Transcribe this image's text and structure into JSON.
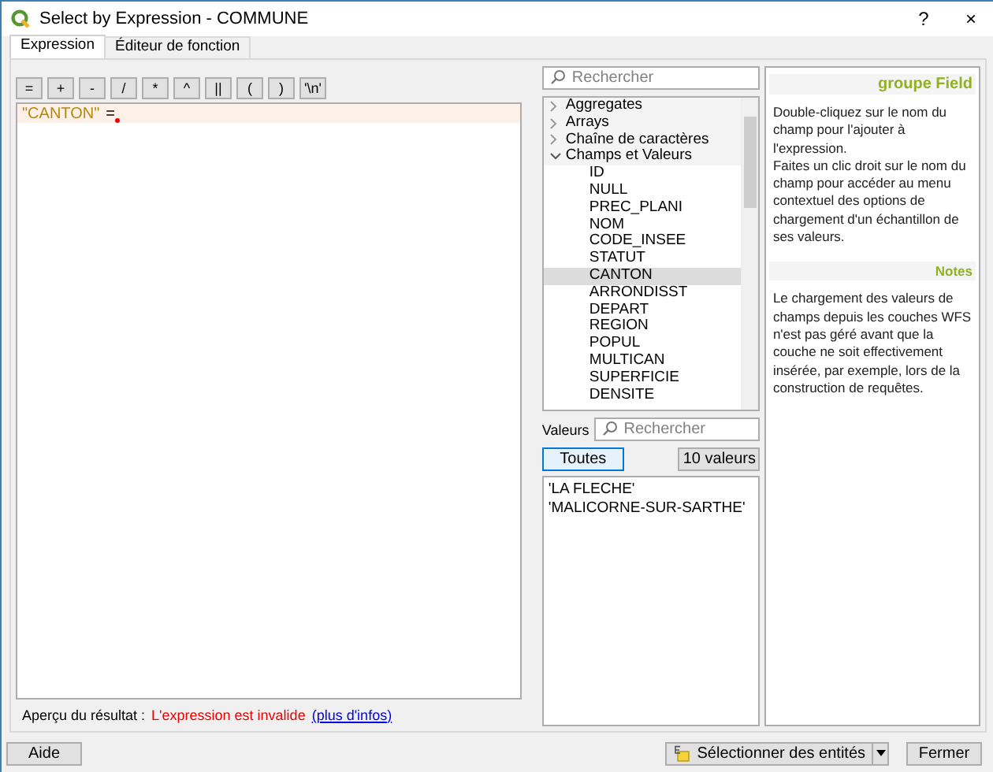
{
  "window": {
    "title": "Select by Expression - COMMUNE",
    "help_button": "?",
    "close_button": "×"
  },
  "tabs": [
    {
      "label": "Expression",
      "selected": true
    },
    {
      "label": "Éditeur de fonction",
      "selected": false
    }
  ],
  "operators": [
    "=",
    "+",
    "-",
    "/",
    "*",
    "^",
    "||",
    "(",
    ")",
    "'\\n'"
  ],
  "expression": {
    "tokens": [
      {
        "text": "\"CANTON\"",
        "kind": "field"
      },
      {
        "text": "=",
        "kind": "operator"
      }
    ],
    "error": true
  },
  "preview": {
    "label": "Aperçu du résultat :",
    "message": "L'expression est invalide",
    "link": "(plus d'infos)"
  },
  "function_search": {
    "placeholder": "Rechercher"
  },
  "tree": [
    {
      "label": "Aggregates",
      "expanded": false,
      "selected": false
    },
    {
      "label": "Arrays",
      "expanded": false,
      "selected": false
    },
    {
      "label": "Chaîne de caractères",
      "expanded": false,
      "selected": false
    },
    {
      "label": "Champs et Valeurs",
      "expanded": true,
      "selected": false,
      "children": [
        {
          "label": "ID",
          "selected": false
        },
        {
          "label": "NULL",
          "selected": false
        },
        {
          "label": "PREC_PLANI",
          "selected": false
        },
        {
          "label": "NOM",
          "selected": false
        },
        {
          "label": "CODE_INSEE",
          "selected": false
        },
        {
          "label": "STATUT",
          "selected": false
        },
        {
          "label": "CANTON",
          "selected": true
        },
        {
          "label": "ARRONDISST",
          "selected": false
        },
        {
          "label": "DEPART",
          "selected": false
        },
        {
          "label": "REGION",
          "selected": false
        },
        {
          "label": "POPUL",
          "selected": false
        },
        {
          "label": "MULTICAN",
          "selected": false
        },
        {
          "label": "SUPERFICIE",
          "selected": false
        },
        {
          "label": "DENSITE",
          "selected": false
        }
      ]
    }
  ],
  "values": {
    "label": "Valeurs",
    "placeholder": "Rechercher",
    "buttons": [
      {
        "label": "Toutes",
        "selected": true
      },
      {
        "label": "10 valeurs",
        "selected": false
      }
    ],
    "items": [
      "'LA FLECHE'",
      "'MALICORNE-SUR-SARTHE'"
    ]
  },
  "help": {
    "title": "groupe Field",
    "text": "Double-cliquez sur le nom du champ pour l'ajouter à l'expression.\nFaites un clic droit sur le nom du champ pour accéder au menu contextuel des options de chargement d'un échantillon de ses valeurs.",
    "notes_title": "Notes",
    "notes": "Le chargement des valeurs de champs depuis les couches WFS n'est pas géré avant que la couche ne soit effectivement insérée, par exemple, lors de la construction de requêtes."
  },
  "footer": {
    "help_button": "Aide",
    "select_button": "Sélectionner des entités",
    "close_button": "Fermer"
  }
}
